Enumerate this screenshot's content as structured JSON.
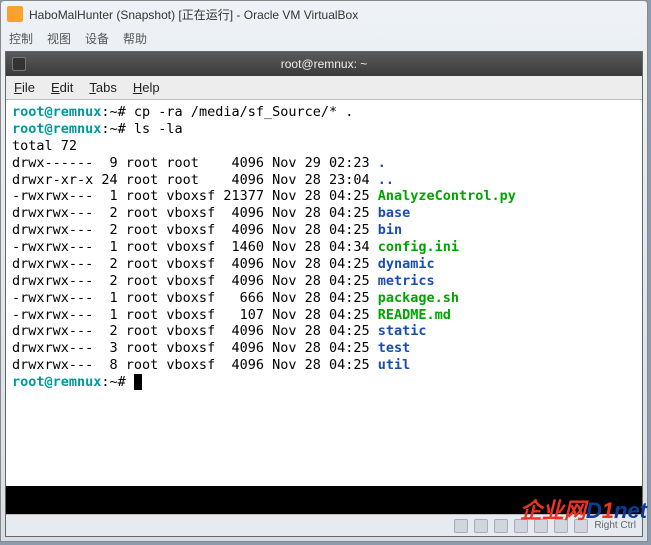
{
  "outer": {
    "title": "HaboMalHunter (Snapshot) [正在运行] - Oracle VM VirtualBox",
    "menu": [
      "控制",
      "视图",
      "设备",
      "帮助"
    ]
  },
  "inner": {
    "title": "root@remnux: ~",
    "menu": [
      "File",
      "Edit",
      "Tabs",
      "Help"
    ]
  },
  "prompt": {
    "user_host": "root@remnux",
    "path": ":~#"
  },
  "commands": [
    "cp -ra /media/sf_Source/* .",
    "ls -la"
  ],
  "total_line": "total 72",
  "ls_rows": [
    {
      "perms": "drwx------",
      "links": "9",
      "owner": "root",
      "group": "root",
      "size": "4096",
      "date": "Nov 29 02:23",
      "name": ".",
      "cls": "blue"
    },
    {
      "perms": "drwxr-xr-x",
      "links": "24",
      "owner": "root",
      "group": "root",
      "size": "4096",
      "date": "Nov 28 23:04",
      "name": "..",
      "cls": "blue"
    },
    {
      "perms": "-rwxrwx---",
      "links": "1",
      "owner": "root",
      "group": "vboxsf",
      "size": "21377",
      "date": "Nov 28 04:25",
      "name": "AnalyzeControl.py",
      "cls": "green"
    },
    {
      "perms": "drwxrwx---",
      "links": "2",
      "owner": "root",
      "group": "vboxsf",
      "size": "4096",
      "date": "Nov 28 04:25",
      "name": "base",
      "cls": "blue"
    },
    {
      "perms": "drwxrwx---",
      "links": "2",
      "owner": "root",
      "group": "vboxsf",
      "size": "4096",
      "date": "Nov 28 04:25",
      "name": "bin",
      "cls": "blue"
    },
    {
      "perms": "-rwxrwx---",
      "links": "1",
      "owner": "root",
      "group": "vboxsf",
      "size": "1460",
      "date": "Nov 28 04:34",
      "name": "config.ini",
      "cls": "green"
    },
    {
      "perms": "drwxrwx---",
      "links": "2",
      "owner": "root",
      "group": "vboxsf",
      "size": "4096",
      "date": "Nov 28 04:25",
      "name": "dynamic",
      "cls": "blue"
    },
    {
      "perms": "drwxrwx---",
      "links": "2",
      "owner": "root",
      "group": "vboxsf",
      "size": "4096",
      "date": "Nov 28 04:25",
      "name": "metrics",
      "cls": "blue"
    },
    {
      "perms": "-rwxrwx---",
      "links": "1",
      "owner": "root",
      "group": "vboxsf",
      "size": "666",
      "date": "Nov 28 04:25",
      "name": "package.sh",
      "cls": "green"
    },
    {
      "perms": "-rwxrwx---",
      "links": "1",
      "owner": "root",
      "group": "vboxsf",
      "size": "107",
      "date": "Nov 28 04:25",
      "name": "README.md",
      "cls": "green"
    },
    {
      "perms": "drwxrwx---",
      "links": "2",
      "owner": "root",
      "group": "vboxsf",
      "size": "4096",
      "date": "Nov 28 04:25",
      "name": "static",
      "cls": "blue"
    },
    {
      "perms": "drwxrwx---",
      "links": "3",
      "owner": "root",
      "group": "vboxsf",
      "size": "4096",
      "date": "Nov 28 04:25",
      "name": "test",
      "cls": "blue"
    },
    {
      "perms": "drwxrwx---",
      "links": "8",
      "owner": "root",
      "group": "vboxsf",
      "size": "4096",
      "date": "Nov 28 04:25",
      "name": "util",
      "cls": "blue"
    }
  ],
  "statusbar": {
    "text": "Right Ctrl"
  },
  "watermark": {
    "zh": "企业网",
    "d": "D",
    "one": "1",
    "net": "net"
  }
}
